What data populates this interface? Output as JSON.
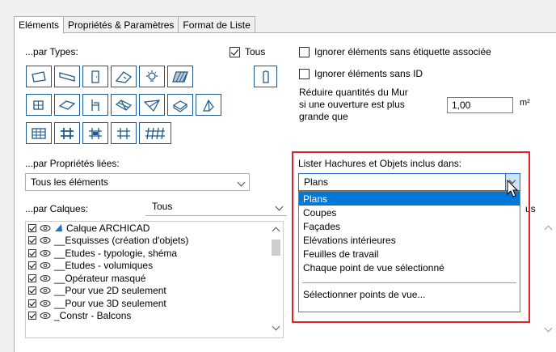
{
  "tabs": [
    {
      "label": "Eléments",
      "active": true
    },
    {
      "label": "Propriétés & Paramètres",
      "active": false
    },
    {
      "label": "Format de Liste",
      "active": false
    }
  ],
  "types": {
    "label": "...par Types:",
    "all_label": "Tous",
    "all_checked": true,
    "icons": [
      "wall-icon",
      "beam-icon",
      "door-icon",
      "window-icon",
      "lamp-icon",
      "hatch-icon",
      "column-icon",
      "object-icon",
      "slab-icon",
      "chair-icon",
      "roof-icon",
      "shell-icon",
      "morph-icon",
      "skylight-icon",
      "curtain-wall-icon",
      "rail-icon",
      "stair-icon",
      "railing-icon",
      "beam-grid-icon"
    ]
  },
  "linked": {
    "label": "...par Propriétés liées:",
    "value": "Tous les éléments"
  },
  "layers": {
    "label": "...par Calques:",
    "filter_value": "Tous",
    "items": [
      {
        "label": "Calque ARCHICAD",
        "special": true
      },
      {
        "label": "__Esquisses (création d'objets)"
      },
      {
        "label": "__Etudes - typologie, shéma"
      },
      {
        "label": "__Etudes - volumiques"
      },
      {
        "label": "__Opérateur masqué"
      },
      {
        "label": "__Pour vue 2D seulement"
      },
      {
        "label": "__Pour vue 3D seulement"
      },
      {
        "label": "_Constr - Balcons"
      }
    ]
  },
  "options": {
    "ignore_no_label": "Ignorer éléments sans étiquette associée",
    "ignore_no_id": "Ignorer éléments sans ID",
    "reduce_wall_line1": "Réduire quantités du Mur",
    "reduce_wall_line2": "si une ouverture est plus",
    "reduce_wall_line3": "grande que",
    "area_value": "1,00",
    "area_unit": "m²"
  },
  "hatch_list": {
    "label": "Lister Hachures et Objets inclus dans:",
    "selected": "Plans",
    "options": [
      "Plans",
      "Coupes",
      "Façades",
      "Elévations intérieures",
      "Feuilles de travail",
      "Chaque point de vue sélectionné"
    ],
    "extra_option": "Sélectionner points de vue...",
    "partial_text": "us"
  },
  "colors": {
    "accent": "#1e5a8c",
    "highlight": "#0078d7",
    "red_frame": "#e0222a"
  }
}
